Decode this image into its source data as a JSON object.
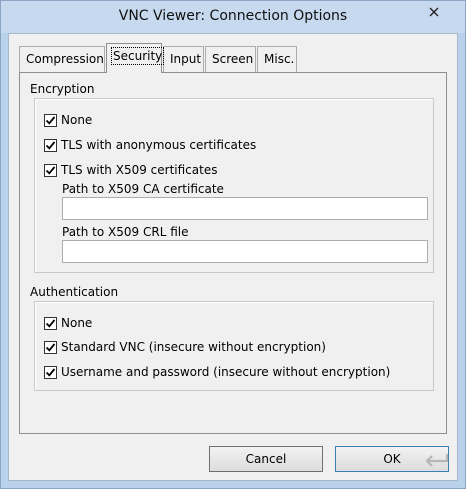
{
  "window": {
    "title": "VNC Viewer: Connection Options"
  },
  "tabs": [
    {
      "label": "Compression",
      "active": false
    },
    {
      "label": "Security",
      "active": true
    },
    {
      "label": "Input",
      "active": false
    },
    {
      "label": "Screen",
      "active": false
    },
    {
      "label": "Misc.",
      "active": false
    }
  ],
  "encryption": {
    "title": "Encryption",
    "none_label": "None",
    "none_checked": true,
    "tls_anon_label": "TLS with anonymous certificates",
    "tls_anon_checked": true,
    "tls_x509_label": "TLS with X509 certificates",
    "tls_x509_checked": true,
    "ca_label": "Path to X509 CA certificate",
    "ca_value": "",
    "crl_label": "Path to X509 CRL file",
    "crl_value": ""
  },
  "authentication": {
    "title": "Authentication",
    "none_label": "None",
    "none_checked": true,
    "standard_label": "Standard VNC (insecure without encryption)",
    "standard_checked": true,
    "userpass_label": "Username and password (insecure without encryption)",
    "userpass_checked": true
  },
  "buttons": {
    "cancel": "Cancel",
    "ok": "OK"
  },
  "icons": {
    "close": "close-icon",
    "check": "check-icon",
    "return": "return-arrow-icon"
  },
  "colors": {
    "titlebar": "#c7d9ef",
    "frame": "#b9d1ea",
    "client": "#f0f0f0"
  }
}
